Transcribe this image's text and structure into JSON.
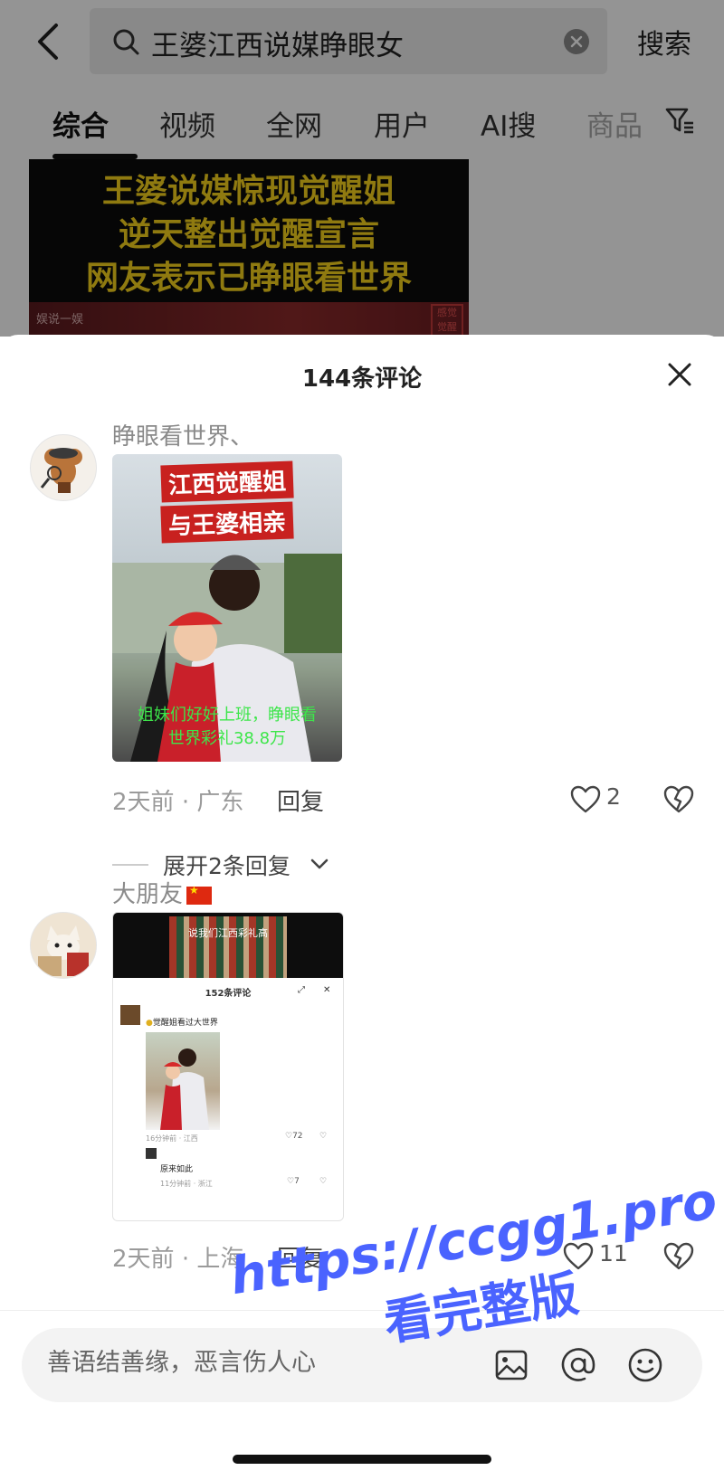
{
  "search": {
    "query": "王婆江西说媒睁眼女",
    "button_label": "搜索"
  },
  "tabs": [
    {
      "label": "综合"
    },
    {
      "label": "视频"
    },
    {
      "label": "全网"
    },
    {
      "label": "用户"
    },
    {
      "label": "AI搜"
    },
    {
      "label": "商品"
    }
  ],
  "video": {
    "title_lines": [
      "王婆说媒惊现觉醒姐",
      "逆天整出觉醒宣言",
      "网友表示已睁眼看世界"
    ],
    "source": "娱说一娱",
    "stamp": "感觉觉醒"
  },
  "sheet": {
    "title": "144条评论"
  },
  "comments": [
    {
      "username": "睁眼看世界、",
      "image_caption_top": [
        "江西觉醒姐",
        "与王婆相亲"
      ],
      "image_caption_bottom": [
        "姐妹们好好上班，睁眼看",
        "世界彩礼38.8万"
      ],
      "time": "2天前",
      "location": "广东",
      "reply_label": "回复",
      "likes": "2"
    },
    {
      "username": "大朋友",
      "image_banner": "说我们江西彩礼高",
      "image_inner_title": "152条评论",
      "image_inner_comment": "觉醒姐看过大世界",
      "image_inner_reply": "原来如此",
      "image_inner_meta1": "16分钟前 · 江西",
      "image_inner_meta2": "11分钟前 · 浙江",
      "image_inner_likes1": "72",
      "image_inner_likes2": "7",
      "time": "2天前",
      "location": "上海",
      "reply_label": "回复",
      "likes": "11"
    }
  ],
  "expand_replies": {
    "label": "展开2条回复"
  },
  "composer": {
    "placeholder": "善语结善缘，恶言伤人心"
  },
  "watermark": {
    "line1": "https://ccgg1.pro",
    "line2": "看完整版"
  },
  "colors": {
    "accent_watermark": "#4a63ff",
    "video_title_yellow": "#f6d21c"
  }
}
